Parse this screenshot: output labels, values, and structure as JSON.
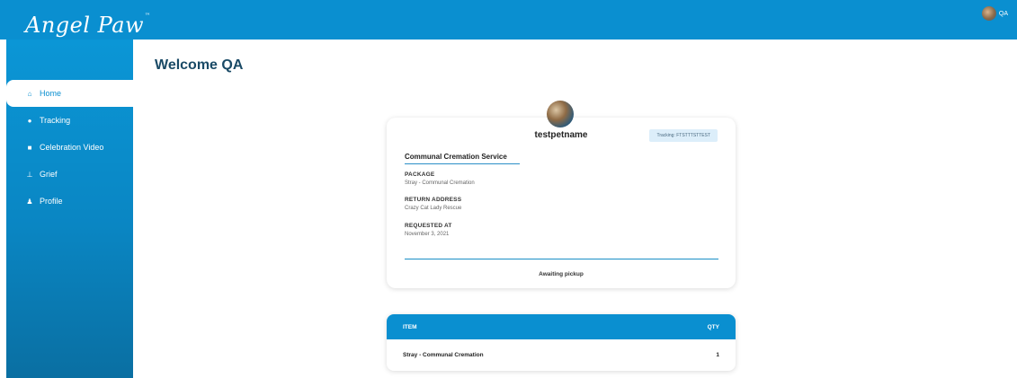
{
  "brand": {
    "name": "Angel Paw",
    "tm": "™"
  },
  "user": {
    "name": "QA"
  },
  "sidebar": {
    "items": [
      {
        "label": "Home",
        "icon": "home-icon",
        "glyph": "⌂",
        "active": true
      },
      {
        "label": "Tracking",
        "icon": "map-pin-icon",
        "glyph": "●"
      },
      {
        "label": "Celebration Video",
        "icon": "video-icon",
        "glyph": "■"
      },
      {
        "label": "Grief",
        "icon": "grief-icon",
        "glyph": "⊥"
      },
      {
        "label": "Profile",
        "icon": "user-icon",
        "glyph": "♟"
      }
    ]
  },
  "header": {
    "welcome": "Welcome QA"
  },
  "pet": {
    "name": "testpetname",
    "tracking": "Tracking: FTSTTTSTTEST",
    "service": "Communal Cremation Service",
    "package_label": "PACKAGE",
    "package_value": "Stray - Communal Cremation",
    "return_label": "RETURN ADDRESS",
    "return_value": "Crazy Cat Lady Rescue",
    "requested_label": "REQUESTED AT",
    "requested_value": "November 3, 2021",
    "status": "Awaiting pickup"
  },
  "items_table": {
    "headers": {
      "item": "ITEM",
      "qty": "QTY"
    },
    "rows": [
      {
        "item": "Stray - Communal Cremation",
        "qty": "1"
      }
    ]
  },
  "colors": {
    "primary": "#0a8fd0",
    "heading": "#1a4a66"
  }
}
